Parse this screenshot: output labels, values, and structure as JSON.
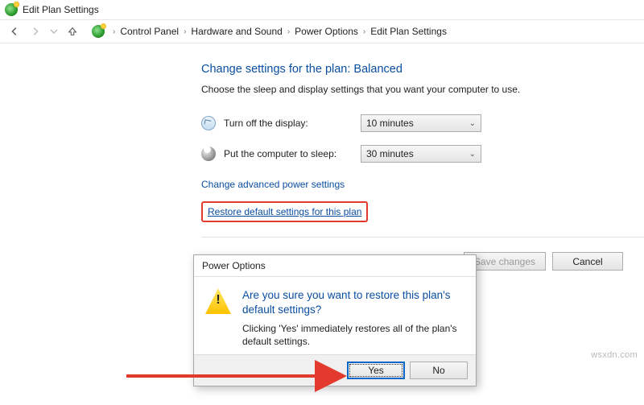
{
  "window": {
    "title": "Edit Plan Settings"
  },
  "breadcrumb": {
    "items": [
      "Control Panel",
      "Hardware and Sound",
      "Power Options",
      "Edit Plan Settings"
    ]
  },
  "page": {
    "heading": "Change settings for the plan: Balanced",
    "subtext": "Choose the sleep and display settings that you want your computer to use.",
    "display_label": "Turn off the display:",
    "display_value": "10 minutes",
    "sleep_label": "Put the computer to sleep:",
    "sleep_value": "30 minutes",
    "advanced_link": "Change advanced power settings",
    "restore_link": "Restore default settings for this plan"
  },
  "footer": {
    "save": "Save changes",
    "cancel": "Cancel"
  },
  "dialog": {
    "title": "Power Options",
    "question": "Are you sure you want to restore this plan's default settings?",
    "message": "Clicking 'Yes' immediately restores all of the plan's default settings.",
    "yes": "Yes",
    "no": "No"
  },
  "watermark": "wsxdn.com"
}
